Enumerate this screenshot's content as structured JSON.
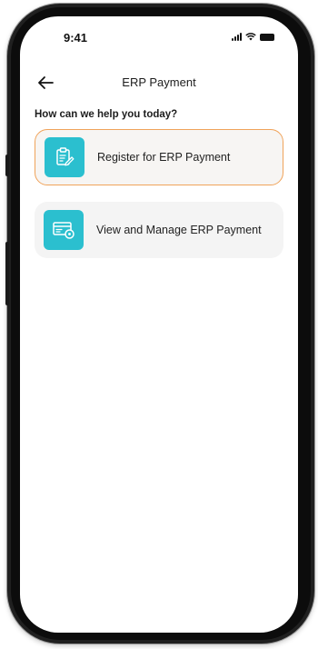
{
  "status_bar": {
    "time": "9:41",
    "icons": [
      "signal-icon",
      "wifi-icon",
      "battery-icon"
    ]
  },
  "header": {
    "back_icon": "arrow-left-icon",
    "title": "ERP Payment"
  },
  "prompt": "How can we help you today?",
  "options": [
    {
      "label": "Register for ERP Payment",
      "icon": "clipboard-edit-icon",
      "selected": true
    },
    {
      "label": "View and Manage ERP Payment",
      "icon": "card-manage-icon",
      "selected": false
    }
  ],
  "colors": {
    "accent": "#2bbfcf",
    "selected_border": "#f0a35a",
    "card_bg": "#f4f4f4"
  }
}
